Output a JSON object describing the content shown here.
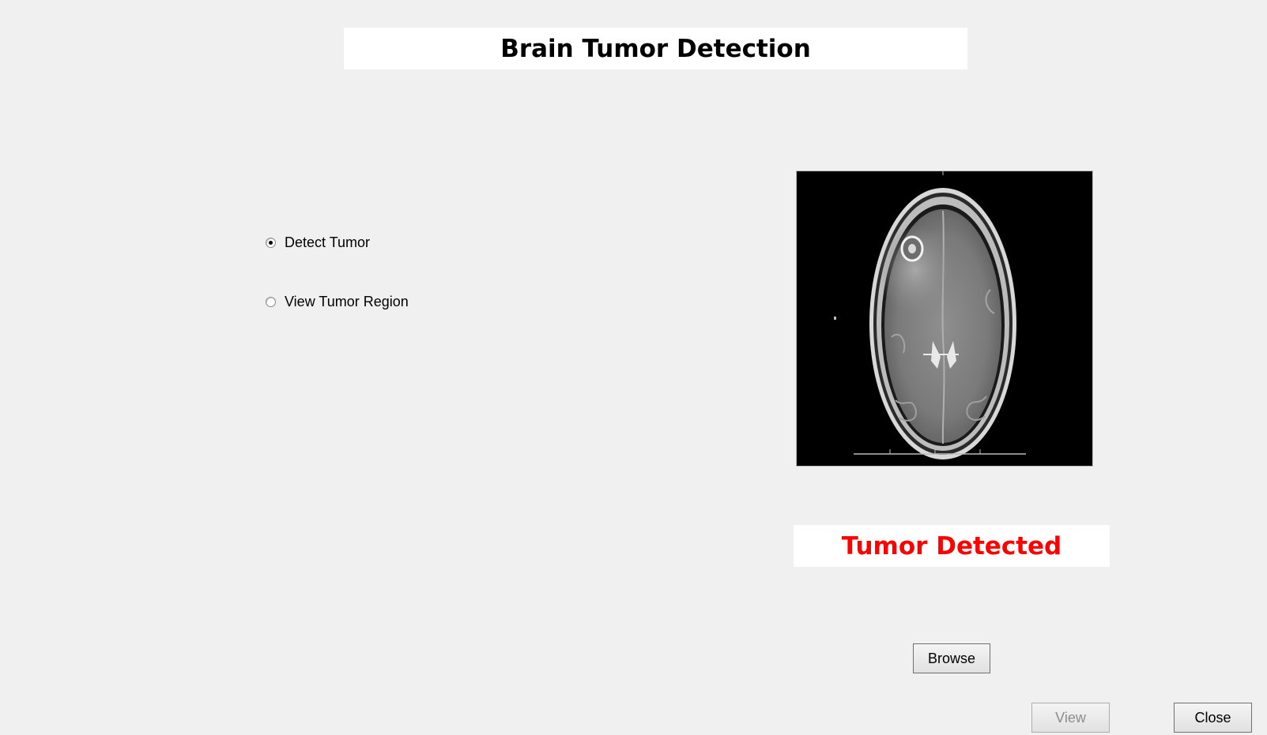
{
  "app": {
    "title": "Brain Tumor Detection"
  },
  "options": {
    "items": [
      {
        "label": "Detect Tumor",
        "selected": true
      },
      {
        "label": "View Tumor Region",
        "selected": false
      }
    ]
  },
  "preview": {
    "image_icon": "brain-mri-scan"
  },
  "result": {
    "text": "Tumor Detected",
    "color": "#ff0000"
  },
  "buttons": {
    "browse_label": "Browse",
    "view_label": "View",
    "view_enabled": false,
    "close_label": "Close"
  }
}
